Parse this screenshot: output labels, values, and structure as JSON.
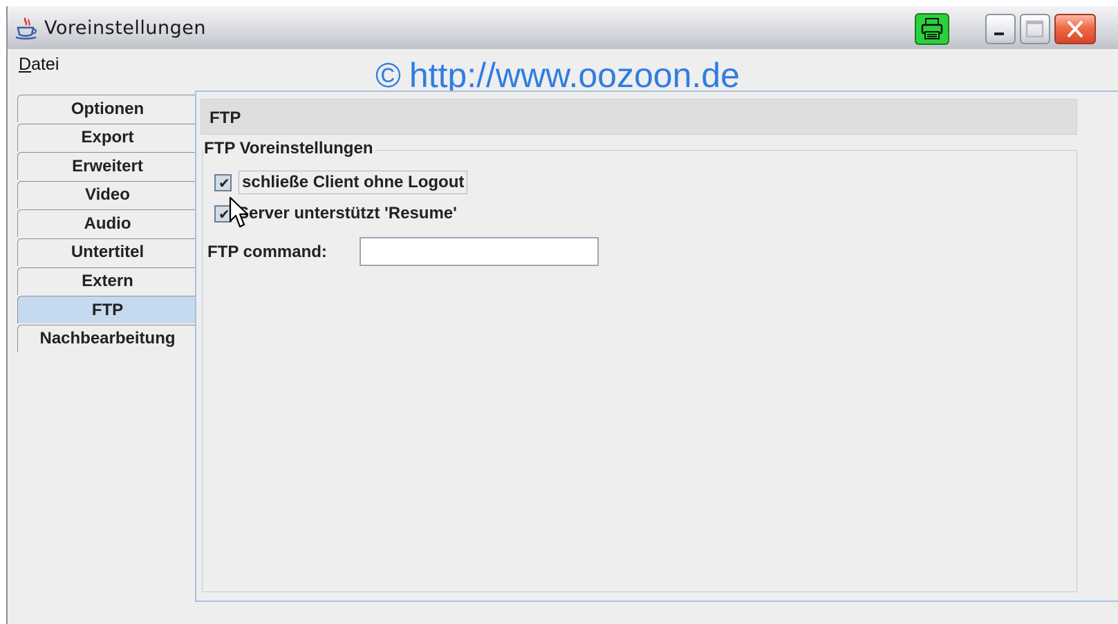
{
  "window": {
    "title": "Voreinstellungen",
    "title_icon": "java-coffee-cup-icon",
    "tray_icon": "printer-icon",
    "controls": [
      "minimize",
      "maximize",
      "close"
    ]
  },
  "menubar": {
    "menus": [
      {
        "label": "Datei",
        "mnemonic": "D",
        "rest": "atei"
      }
    ]
  },
  "watermark": {
    "copyright_symbol": "©",
    "url": "http://www.oozoon.de",
    "color": "#2f7de1"
  },
  "tabs": [
    {
      "label": "Optionen"
    },
    {
      "label": "Export"
    },
    {
      "label": "Erweitert"
    },
    {
      "label": "Video"
    },
    {
      "label": "Audio"
    },
    {
      "label": "Untertitel"
    },
    {
      "label": "Extern"
    },
    {
      "label": "FTP"
    },
    {
      "label": "Nachbearbeitung"
    }
  ],
  "selected_tab": "FTP",
  "panel": {
    "header": "FTP",
    "group_title": "FTP Voreinstellungen",
    "checkboxes": [
      {
        "label": "schließe Client ohne Logout",
        "checked": true
      },
      {
        "label": "Server unterstützt 'Resume'",
        "checked": true
      }
    ],
    "command_label": "FTP command:",
    "command_value": ""
  },
  "colors": {
    "selected_tab": "#c5d9ef",
    "panel_border": "#a9c2df",
    "tray_green": "#2bd13a",
    "close_red": "#e0502f"
  }
}
